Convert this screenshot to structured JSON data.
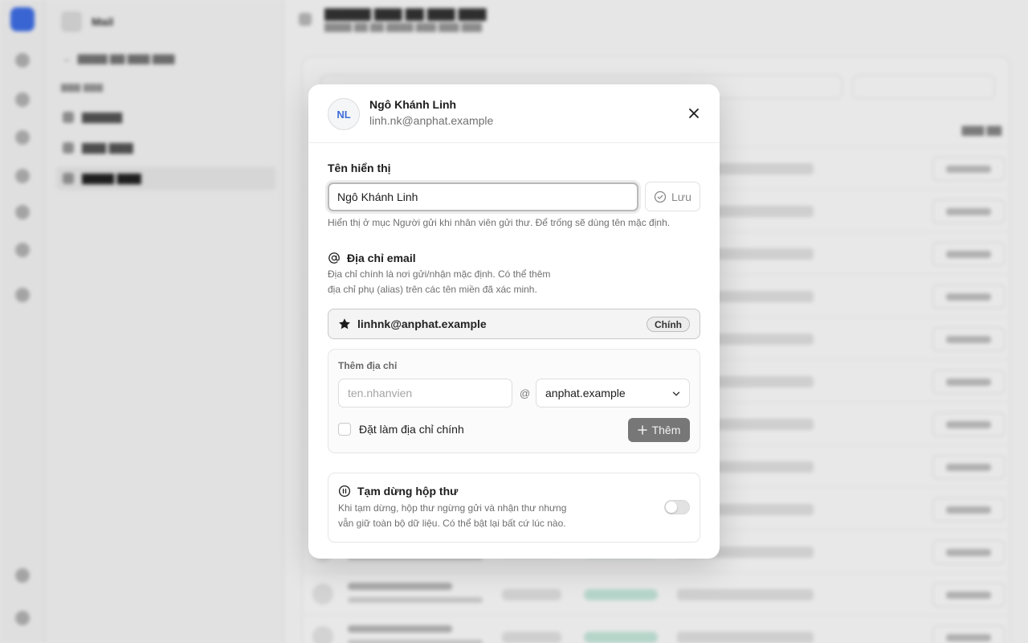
{
  "background": {
    "app_name": "Mail"
  },
  "modal": {
    "avatar_initials": "NL",
    "user_name": "Ngô Khánh Linh",
    "user_email": "linh.nk@anphat.example",
    "display_name": {
      "label": "Tên hiển thị",
      "value": "Ngô Khánh Linh",
      "save_label": "Lưu",
      "hint": "Hiển thị ở mục Người gửi khi nhân viên gửi thư. Để trống sẽ dùng tên mặc định."
    },
    "email": {
      "title": "Địa chỉ email",
      "hint_line1": "Địa chỉ chính là nơi gửi/nhận mặc định. Có thể thêm",
      "hint_line2": "địa chỉ phụ (alias) trên các tên miền đã xác minh.",
      "primary_address": "linhnk@anphat.example",
      "primary_badge": "Chính",
      "add": {
        "title": "Thêm địa chỉ",
        "local_placeholder": "ten.nhanvien",
        "at": "@",
        "domain_selected": "anphat.example",
        "checkbox_label": "Đặt làm địa chỉ chính",
        "add_button_label": "Thêm"
      }
    },
    "pause": {
      "title": "Tạm dừng hộp thư",
      "hint_line1": "Khi tạm dừng, hộp thư ngừng gửi và nhận thư nhưng",
      "hint_line2": "vẫn giữ toàn bộ dữ liệu. Có thể bật lại bất cứ lúc nào.",
      "enabled": false
    }
  },
  "colors": {
    "accent_avatar_text": "#3d6fd6",
    "add_button_bg": "#777777",
    "status_active": "#c9ebdf"
  }
}
